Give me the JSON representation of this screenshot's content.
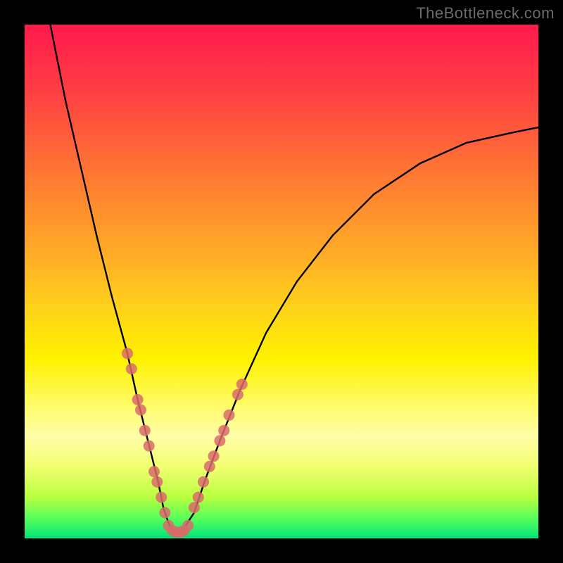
{
  "watermark": "TheBottleneck.com",
  "chart_data": {
    "type": "line",
    "title": "",
    "xlabel": "",
    "ylabel": "",
    "xlim": [
      0,
      100
    ],
    "ylim": [
      0,
      100
    ],
    "grid": false,
    "background_gradient": {
      "top": "#ff1a4d",
      "middle": "#fff200",
      "bottom": "#00e47a"
    },
    "series": [
      {
        "name": "bottleneck-curve",
        "color": "#000000",
        "x": [
          5,
          8,
          11,
          14,
          17,
          20,
          22,
          24,
          26,
          27,
          28,
          29,
          30,
          31,
          33,
          35,
          38,
          42,
          47,
          53,
          60,
          68,
          77,
          86,
          95,
          100
        ],
        "y": [
          100,
          85,
          72,
          59,
          47,
          36,
          27,
          19,
          11,
          6,
          3,
          1,
          1,
          2,
          5,
          11,
          19,
          29,
          40,
          50,
          59,
          67,
          73,
          77,
          79,
          80
        ]
      }
    ],
    "marker_clusters": [
      {
        "name": "left-branch-markers",
        "color": "#d96b6b",
        "points": [
          {
            "x": 20.0,
            "y": 36
          },
          {
            "x": 20.8,
            "y": 33
          },
          {
            "x": 22.0,
            "y": 27
          },
          {
            "x": 22.6,
            "y": 25
          },
          {
            "x": 23.4,
            "y": 21
          },
          {
            "x": 24.2,
            "y": 18
          },
          {
            "x": 25.2,
            "y": 13
          },
          {
            "x": 25.8,
            "y": 11
          },
          {
            "x": 26.6,
            "y": 8
          },
          {
            "x": 27.3,
            "y": 5
          }
        ]
      },
      {
        "name": "valley-markers",
        "color": "#d96b6b",
        "points": [
          {
            "x": 28.0,
            "y": 2.5
          },
          {
            "x": 28.8,
            "y": 1.5
          },
          {
            "x": 29.5,
            "y": 1.2
          },
          {
            "x": 30.3,
            "y": 1.2
          },
          {
            "x": 31.0,
            "y": 1.5
          },
          {
            "x": 31.8,
            "y": 2.5
          }
        ]
      },
      {
        "name": "right-branch-markers",
        "color": "#d96b6b",
        "points": [
          {
            "x": 33.0,
            "y": 6
          },
          {
            "x": 33.8,
            "y": 8
          },
          {
            "x": 34.8,
            "y": 11
          },
          {
            "x": 36.0,
            "y": 14
          },
          {
            "x": 36.8,
            "y": 16
          },
          {
            "x": 38.0,
            "y": 19
          },
          {
            "x": 38.8,
            "y": 21
          },
          {
            "x": 39.8,
            "y": 24
          },
          {
            "x": 41.5,
            "y": 28
          },
          {
            "x": 42.3,
            "y": 30
          }
        ]
      }
    ]
  }
}
